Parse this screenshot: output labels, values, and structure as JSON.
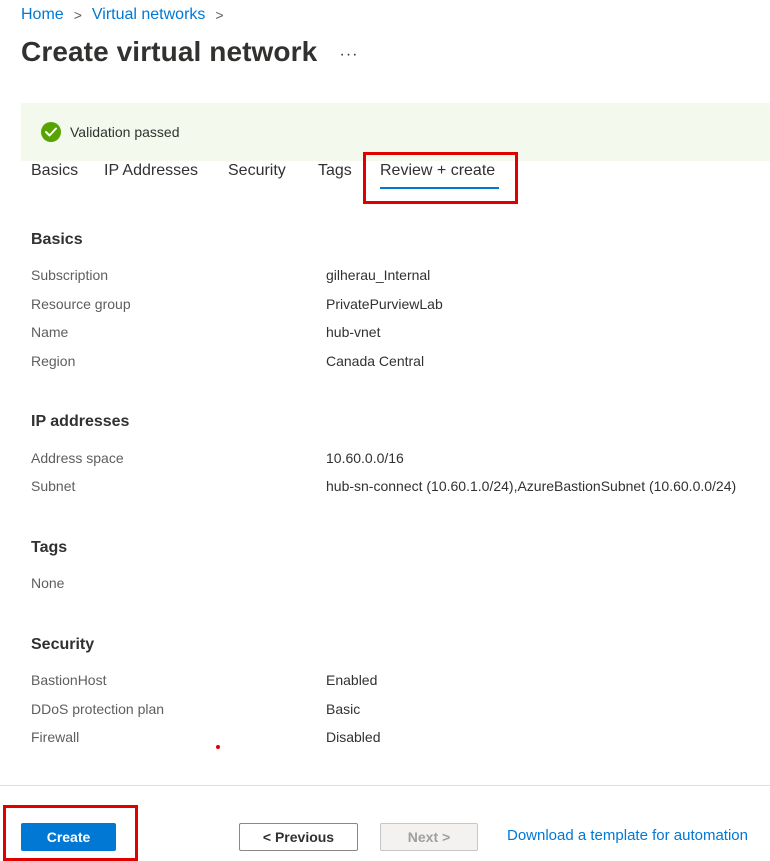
{
  "breadcrumb": {
    "items": [
      "Home",
      "Virtual networks"
    ],
    "separator": ">"
  },
  "page": {
    "title": "Create virtual network",
    "more_label": "···"
  },
  "validation": {
    "text": "Validation passed",
    "icon": "checkmark-circle-icon",
    "color": "#57a300"
  },
  "tabs": [
    {
      "label": "Basics"
    },
    {
      "label": "IP Addresses"
    },
    {
      "label": "Security"
    },
    {
      "label": "Tags"
    },
    {
      "label": "Review + create",
      "active": true
    }
  ],
  "sections": {
    "basics": {
      "heading": "Basics",
      "rows": [
        {
          "label": "Subscription",
          "value": "gilherau_Internal"
        },
        {
          "label": "Resource group",
          "value": "PrivatePurviewLab"
        },
        {
          "label": "Name",
          "value": "hub-vnet"
        },
        {
          "label": "Region",
          "value": "Canada Central"
        }
      ]
    },
    "ip_addresses": {
      "heading": "IP addresses",
      "rows": [
        {
          "label": "Address space",
          "value": "10.60.0.0/16"
        },
        {
          "label": "Subnet",
          "value": "hub-sn-connect (10.60.1.0/24),AzureBastionSubnet (10.60.0.0/24)"
        }
      ]
    },
    "tags": {
      "heading": "Tags",
      "none_text": "None"
    },
    "security": {
      "heading": "Security",
      "rows": [
        {
          "label": "BastionHost",
          "value": "Enabled"
        },
        {
          "label": "DDoS protection plan",
          "value": "Basic"
        },
        {
          "label": "Firewall",
          "value": "Disabled"
        }
      ]
    }
  },
  "footer": {
    "create_label": "Create",
    "previous_label": "< Previous",
    "next_label": "Next >",
    "download_label": "Download a template for automation"
  },
  "colors": {
    "accent": "#0078d4",
    "highlight": "#e00000",
    "banner_bg": "#f3f9ed"
  }
}
